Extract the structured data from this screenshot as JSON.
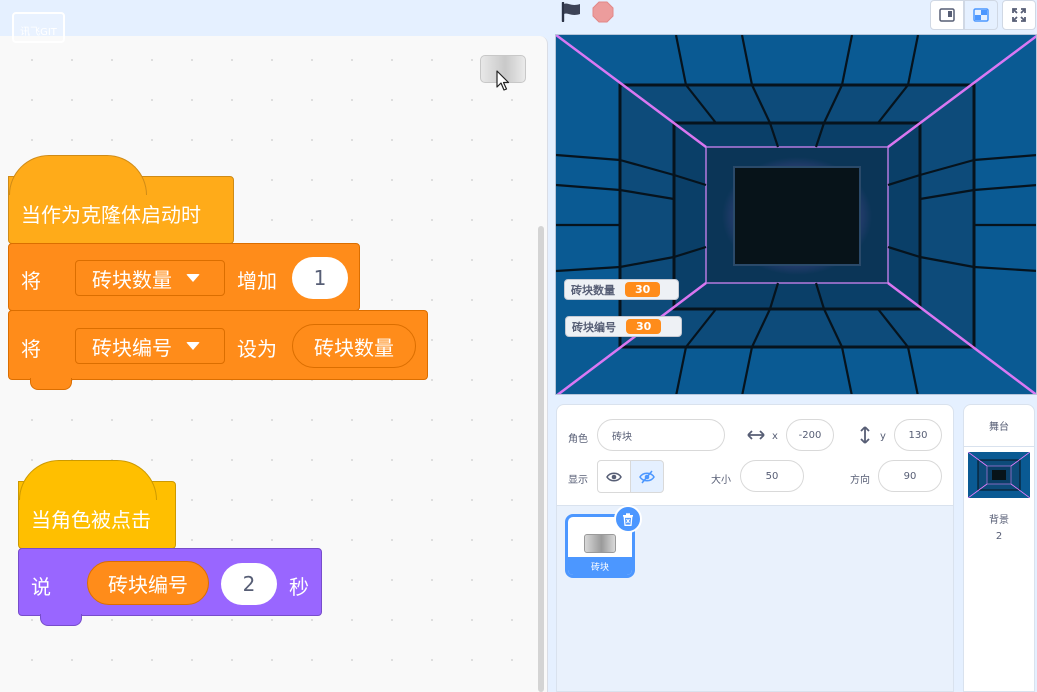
{
  "logo_text": "讯飞GIT",
  "code": {
    "script1": {
      "hat": "当作为克隆体启动时",
      "line1": {
        "verb": "将",
        "variable": "砖块数量",
        "op": "增加",
        "value": "1"
      },
      "line2": {
        "verb": "将",
        "variable": "砖块编号",
        "op": "设为",
        "value": "砖块数量"
      }
    },
    "script2": {
      "hat": "当角色被点击",
      "say": {
        "verb": "说",
        "value": "砖块编号",
        "secs": "2",
        "unit": "秒"
      }
    }
  },
  "stage": {
    "monitors": [
      {
        "label": "砖块数量",
        "value": "30"
      },
      {
        "label": "砖块编号",
        "value": "30"
      }
    ]
  },
  "sprite_info": {
    "sprite_label": "角色",
    "sprite_name": "砖块",
    "x_label": "x",
    "x": "-200",
    "y_label": "y",
    "y": "130",
    "show_label": "显示",
    "size_label": "大小",
    "size": "50",
    "direction_label": "方向",
    "direction": "90"
  },
  "sprites": [
    {
      "name": "砖块"
    }
  ],
  "stage_panel": {
    "title": "舞台",
    "backdrops_label": "背景",
    "backdrops_count": "2"
  },
  "colors": {
    "events": "#ffbf00",
    "control": "#ffab19",
    "variables": "#ff8c1a",
    "looks": "#9966ff",
    "accent": "#4c97ff"
  },
  "icons": [
    "green-flag-icon",
    "stop-icon",
    "small-stage-icon",
    "normal-stage-icon",
    "fullscreen-icon",
    "eye-icon",
    "eye-slash-icon",
    "trash-icon",
    "horizontal-arrows-icon",
    "vertical-arrows-icon",
    "dropdown-caret-icon"
  ]
}
